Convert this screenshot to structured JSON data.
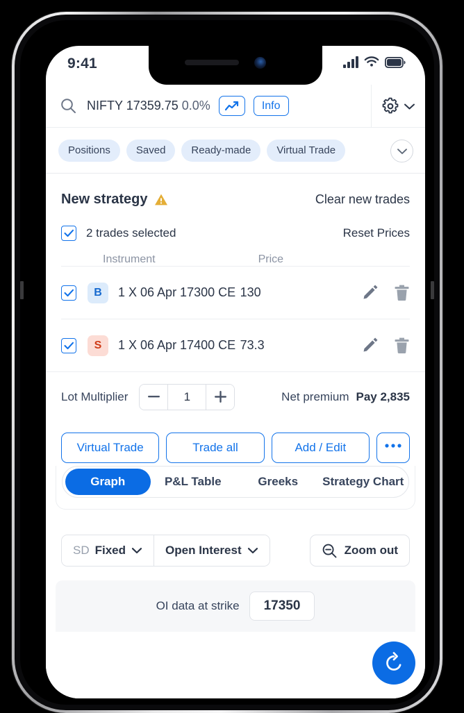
{
  "status_bar": {
    "time": "9:41",
    "signal_icon": "cellular-signal-icon",
    "wifi_icon": "wifi-icon",
    "battery_icon": "battery-full-icon"
  },
  "search_bar": {
    "search_icon": "search-icon",
    "symbol": "NIFTY",
    "price": "17359.75",
    "change": "0.0%",
    "chart_toggle_icon": "trending-up-icon",
    "info_label": "Info",
    "settings_icon": "gear-icon",
    "settings_chevron_icon": "chevron-down-icon"
  },
  "chips": {
    "items": [
      {
        "label": "Positions"
      },
      {
        "label": "Saved"
      },
      {
        "label": "Ready-made"
      },
      {
        "label": "Virtual Trade"
      }
    ],
    "expand_icon": "chevron-down-icon"
  },
  "strategy": {
    "title": "New strategy",
    "warning_icon": "warning-triangle-icon",
    "warning_color": "#e4ae37",
    "clear_label": "Clear new trades"
  },
  "trades_panel": {
    "select_all_label": "2 trades selected",
    "reset_prices_label": "Reset Prices",
    "columns": {
      "instrument": "Instrument",
      "price": "Price"
    },
    "rows": [
      {
        "side": "B",
        "side_type": "buy",
        "instrument": "1 X 06 Apr 17300 CE",
        "price": "130",
        "edit_icon": "pencil-icon",
        "delete_icon": "trash-icon"
      },
      {
        "side": "S",
        "side_type": "sell",
        "instrument": "1 X 06 Apr 17400 CE",
        "price": "73.3",
        "edit_icon": "pencil-icon",
        "delete_icon": "trash-icon"
      }
    ]
  },
  "lot_multiplier": {
    "label": "Lot Multiplier",
    "decrement_icon": "minus-icon",
    "value": "1",
    "increment_icon": "plus-icon",
    "premium_label": "Net premium",
    "premium_value": "Pay 2,835"
  },
  "actions": {
    "virtual_trade": "Virtual Trade",
    "trade_all": "Trade all",
    "add_edit": "Add / Edit",
    "more_icon": "ellipsis-icon"
  },
  "view_tabs": {
    "items": [
      {
        "label": "Graph",
        "active": true
      },
      {
        "label": "P&L Table",
        "active": false
      },
      {
        "label": "Greeks",
        "active": false
      },
      {
        "label": "Strategy Chart",
        "active": false
      }
    ]
  },
  "chart_controls": {
    "sd_prefix": "SD",
    "sd_value": "Fixed",
    "sd_chevron_icon": "chevron-down-icon",
    "overlay_value": "Open Interest",
    "overlay_chevron_icon": "chevron-down-icon",
    "zoom_out_icon": "zoom-out-icon",
    "zoom_out_label": "Zoom out"
  },
  "oi_strip": {
    "label": "OI data at strike",
    "strike": "17350"
  },
  "fab": {
    "icon": "refresh-icon"
  },
  "theme": {
    "accent": "#0b6ce4",
    "link": "#1273ea",
    "text": "#2b3547",
    "muted": "#8b93a3",
    "buy_bg": "#dcebfb",
    "buy_fg": "#1669cf",
    "sell_bg": "#fcdcd5",
    "sell_fg": "#cf3c18"
  }
}
